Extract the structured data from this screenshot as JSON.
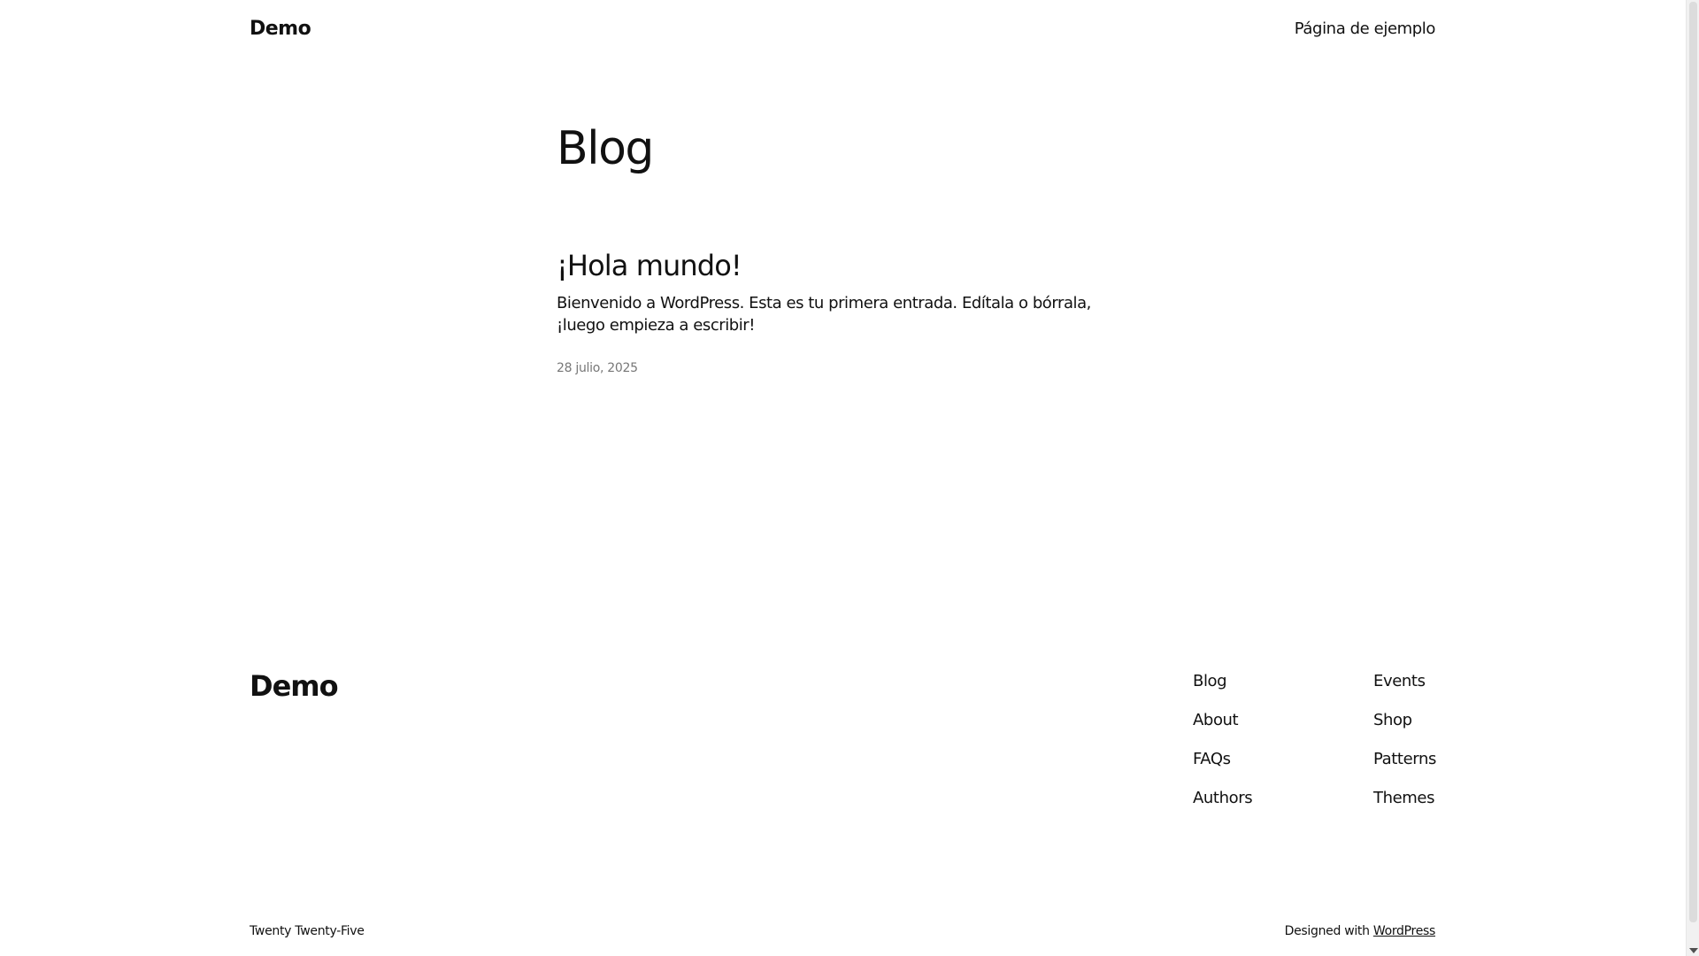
{
  "header": {
    "site_title": "Demo",
    "nav": [
      {
        "label": "Página de ejemplo"
      }
    ]
  },
  "main": {
    "page_title": "Blog",
    "posts": [
      {
        "title": "¡Hola mundo!",
        "excerpt": "Bienvenido a WordPress. Esta es tu primera entrada. Edítala o bórrala, ¡luego empieza a escribir!",
        "date": "28 julio, 2025"
      }
    ]
  },
  "footer": {
    "site_title": "Demo",
    "nav_col1": [
      {
        "label": "Blog"
      },
      {
        "label": "About"
      },
      {
        "label": "FAQs"
      },
      {
        "label": "Authors"
      }
    ],
    "nav_col2": [
      {
        "label": "Events"
      },
      {
        "label": "Shop"
      },
      {
        "label": "Patterns"
      },
      {
        "label": "Themes"
      }
    ],
    "theme_credit": "Twenty Twenty-Five",
    "designed_with_prefix": "Designed with ",
    "designed_with_link": "WordPress"
  }
}
